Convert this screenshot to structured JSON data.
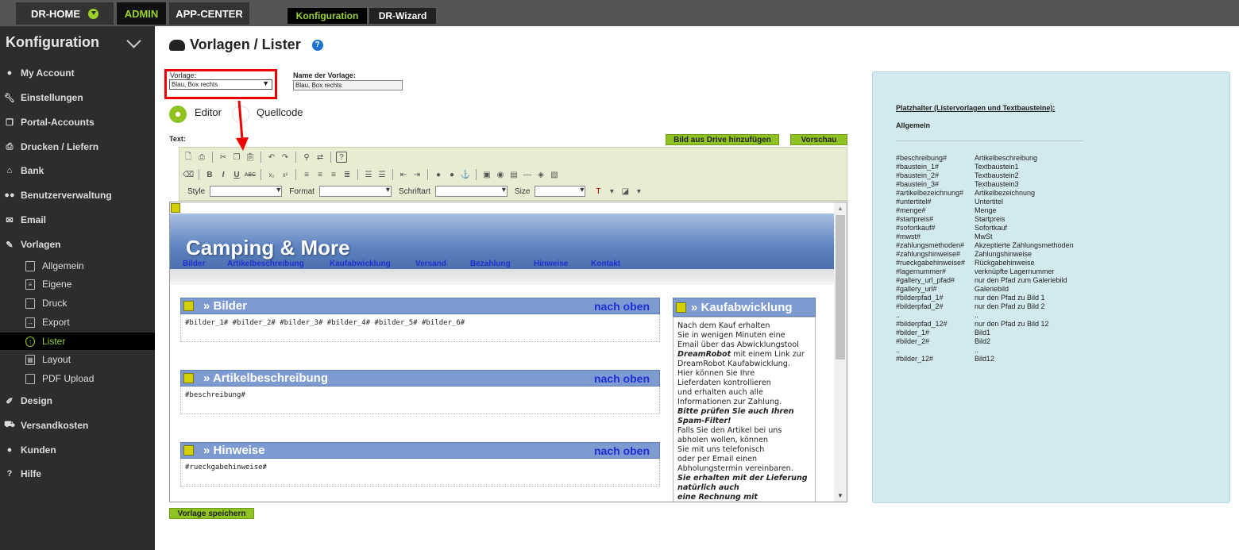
{
  "topbar": {
    "tabs": [
      {
        "label": "DR-HOME"
      },
      {
        "label": "ADMIN"
      },
      {
        "label": "APP-CENTER"
      }
    ],
    "subtabs": [
      {
        "label": "Konfiguration"
      },
      {
        "label": "DR-Wizard"
      }
    ]
  },
  "sidebar": {
    "title": "Konfiguration",
    "items": [
      {
        "label": "My Account",
        "icon": "user-circle-icon"
      },
      {
        "label": "Einstellungen",
        "icon": "wrench-icon"
      },
      {
        "label": "Portal-Accounts",
        "icon": "copy-icon"
      },
      {
        "label": "Drucken / Liefern",
        "icon": "printer-icon"
      },
      {
        "label": "Bank",
        "icon": "bank-icon"
      },
      {
        "label": "Benutzerverwaltung",
        "icon": "users-icon"
      },
      {
        "label": "Email",
        "icon": "envelope-icon"
      },
      {
        "label": "Vorlagen",
        "icon": "edit-icon"
      }
    ],
    "subitems": [
      {
        "label": "Allgemein"
      },
      {
        "label": "Eigene"
      },
      {
        "label": "Druck"
      },
      {
        "label": "Export"
      },
      {
        "label": "Lister"
      },
      {
        "label": "Layout"
      },
      {
        "label": "PDF Upload"
      }
    ],
    "items_after": [
      {
        "label": "Design",
        "icon": "brush-icon"
      },
      {
        "label": "Versandkosten",
        "icon": "truck-icon"
      },
      {
        "label": "Kunden",
        "icon": "user-icon"
      },
      {
        "label": "Hilfe",
        "icon": "question-icon"
      }
    ]
  },
  "page": {
    "title": "Vorlagen / Lister",
    "help": "?"
  },
  "form": {
    "vorlage_label": "Vorlage:",
    "vorlage_value": "Blau, Box rechts",
    "name_label": "Name der Vorlage:",
    "name_value": "Blau, Box rechts",
    "mode_editor": "Editor",
    "mode_quellcode": "Quellcode",
    "text_label": "Text:",
    "btn_drive": "Bild aus Drive hinzufügen",
    "btn_preview": "Vorschau",
    "btn_save": "Vorlage speichern"
  },
  "toolbar": {
    "style_label": "Style",
    "format_label": "Format",
    "font_label": "Schriftart",
    "size_label": "Size"
  },
  "editor": {
    "banner_title": "Camping & More",
    "nav": [
      "Bilder",
      "Artikelbeschreibung",
      "Kaufabwicklung",
      "Versand",
      "Bezahlung",
      "Hinweise",
      "Kontakt"
    ],
    "sections": [
      {
        "title": "» Bilder",
        "top": "nach oben",
        "body": "#bilder_1# #bilder_2# #bilder_3# #bilder_4# #bilder_5# #bilder_6#"
      },
      {
        "title": "» Artikelbeschreibung",
        "top": "nach oben",
        "body": "#beschreibung#"
      },
      {
        "title": "» Hinweise",
        "top": "nach oben",
        "body": "#rueckgabehinweise#"
      }
    ],
    "side_title": "» Kaufabwicklung",
    "side_lines": [
      {
        "t": "Nach dem Kauf erhalten",
        "s": "n"
      },
      {
        "t": "Sie in wenigen Minuten eine",
        "s": "n"
      },
      {
        "t": "Email über das Abwicklungstool",
        "s": "n"
      },
      {
        "t": "DreamRobot",
        "s": "bi",
        "rest": " mit einem Link zur"
      },
      {
        "t": "DreamRobot Kaufabwicklung.",
        "s": "n"
      },
      {
        "t": "Hier können Sie Ihre",
        "s": "n"
      },
      {
        "t": "Lieferdaten kontrollieren",
        "s": "n"
      },
      {
        "t": "und erhalten auch alle",
        "s": "n"
      },
      {
        "t": "Informationen zur Zahlung.",
        "s": "n"
      },
      {
        "t": "Bitte prüfen Sie auch Ihren",
        "s": "bi"
      },
      {
        "t": "Spam-Filter!",
        "s": "bi"
      },
      {
        "t": "Falls Sie den Artikel bei uns",
        "s": "n"
      },
      {
        "t": "abholen wollen, können",
        "s": "n"
      },
      {
        "t": "Sie mit uns telefonisch",
        "s": "n"
      },
      {
        "t": "oder per Email einen",
        "s": "n"
      },
      {
        "t": "Abholungstermin vereinbaren.",
        "s": "n"
      },
      {
        "t": "Sie erhalten mit der Lieferung",
        "s": "bi"
      },
      {
        "t": "natürlich auch",
        "s": "bi"
      },
      {
        "t": "eine Rechnung mit",
        "s": "bi"
      }
    ]
  },
  "placeholders": {
    "title": "Platzhalter (Listervorlagen und Textbausteine):",
    "group": "Allgemein",
    "rows": [
      [
        "#beschreibung#",
        "Artikelbeschreibung"
      ],
      [
        "#baustein_1#",
        "Textbaustein1"
      ],
      [
        "#baustein_2#",
        "Textbaustein2"
      ],
      [
        "#baustein_3#",
        "Textbaustein3"
      ],
      [
        "#artikelbezeichnung#",
        "Artikelbezeichnung"
      ],
      [
        "#untertitel#",
        "Untertitel"
      ],
      [
        "#menge#",
        "Menge"
      ],
      [
        "#startpreis#",
        "Startpreis"
      ],
      [
        "#sofortkauf#",
        "Sofortkauf"
      ],
      [
        "#mwst#",
        "MwSt"
      ],
      [
        "#zahlungsmethoden#",
        "Akzeptierte Zahlungsmethoden"
      ],
      [
        "#zahlungshinweise#",
        "Zahlungshinweise"
      ],
      [
        "#rueckgabehinweise#",
        "Rückgabehinweise"
      ],
      [
        "#lagernummer#",
        "verknüpfte Lagernummer"
      ],
      [
        "#gallery_url_pfad#",
        "nur den Pfad zum Galeriebild"
      ],
      [
        "#gallery_url#",
        "Galeriebild"
      ],
      [
        "#bilderpfad_1#",
        "nur den Pfad zu Bild 1"
      ],
      [
        "#bilderpfad_2#",
        "nur den Pfad zu Bild 2"
      ],
      [
        "..",
        ".."
      ],
      [
        "#bilderpfad_12#",
        "nur den Pfad zu Bild 12"
      ],
      [
        "#bilder_1#",
        "Bild1"
      ],
      [
        "#bilder_2#",
        "Bild2"
      ],
      [
        "..",
        ".."
      ],
      [
        "#bilder_12#",
        "Bild12"
      ]
    ]
  },
  "colors": {
    "accent_green": "#8fc321",
    "sidebar_bg": "#2d2d2d",
    "panel_bg": "#d2eaee",
    "highlight_red": "#e00000",
    "section_blue": "#7d9bd0"
  }
}
